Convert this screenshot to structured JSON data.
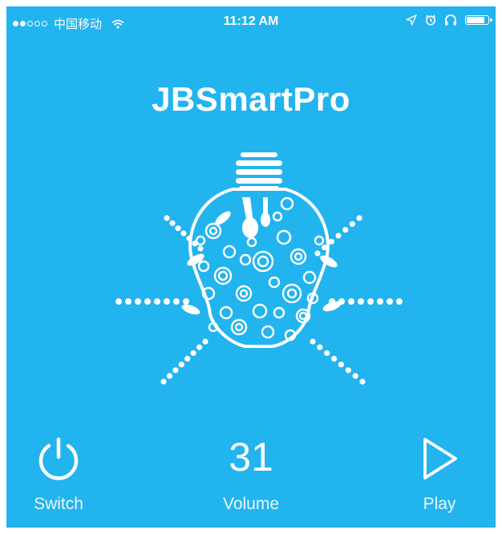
{
  "status_bar": {
    "carrier": "中国移动",
    "time": "11:12 AM",
    "signal_bars_filled": 2,
    "signal_bars_total": 5,
    "battery_level": 0.9,
    "icons": [
      "wifi-icon",
      "location-arrow-icon",
      "alarm-icon",
      "headphones-icon",
      "battery-icon"
    ]
  },
  "app": {
    "title": "JBSmartPro"
  },
  "illustration": {
    "icon": "lightbulb-icon"
  },
  "controls": {
    "switch": {
      "label": "Switch",
      "icon": "power-icon"
    },
    "volume": {
      "label": "Volume",
      "value": "31"
    },
    "play": {
      "label": "Play",
      "icon": "play-icon"
    }
  },
  "colors": {
    "background": "#22b4ee",
    "foreground": "#ffffff"
  }
}
